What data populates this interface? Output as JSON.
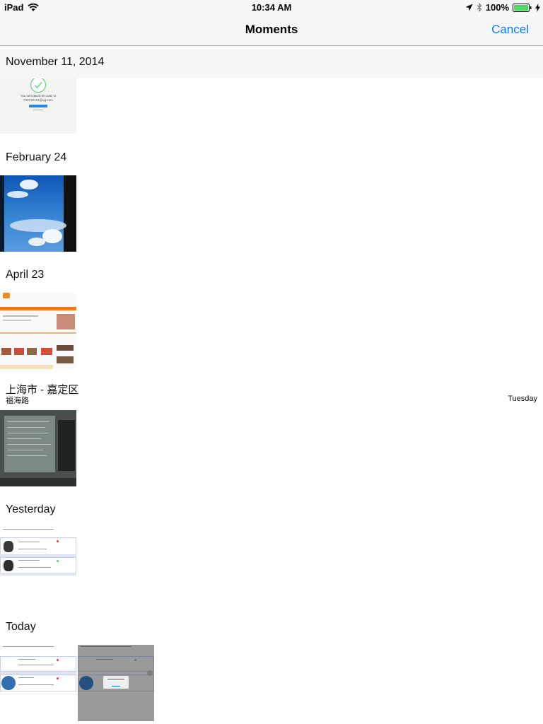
{
  "status_bar": {
    "device": "iPad",
    "time": "10:34 AM",
    "battery": "100%"
  },
  "nav": {
    "title": "Moments",
    "cancel_label": "Cancel"
  },
  "sections": [
    {
      "title": "November 11, 2014",
      "photo": {
        "content": "payment-receipt-screenshot",
        "text_line1": "You sent $620.00 USD to",
        "text_line2": "740730151@qq.com"
      }
    },
    {
      "title": "February 24",
      "photo": {
        "content": "sky-clouds-photo"
      }
    },
    {
      "title": "April 23",
      "photo": {
        "content": "shopping-website-screenshot"
      }
    },
    {
      "title": "上海市 - 嘉定区",
      "subtitle": "福海路",
      "right_label": "Tuesday",
      "photo": {
        "content": "computer-screen-photo"
      }
    },
    {
      "title": "Yesterday",
      "photo": {
        "content": "contact-list-screenshot"
      }
    },
    {
      "title": "Today",
      "photos": [
        {
          "content": "contact-list-screenshot"
        },
        {
          "content": "contact-list-alert-screenshot"
        }
      ]
    }
  ],
  "colors": {
    "accent": "#0a7aff",
    "bar_background": "#f7f7f7",
    "battery_green": "#4cd964"
  }
}
